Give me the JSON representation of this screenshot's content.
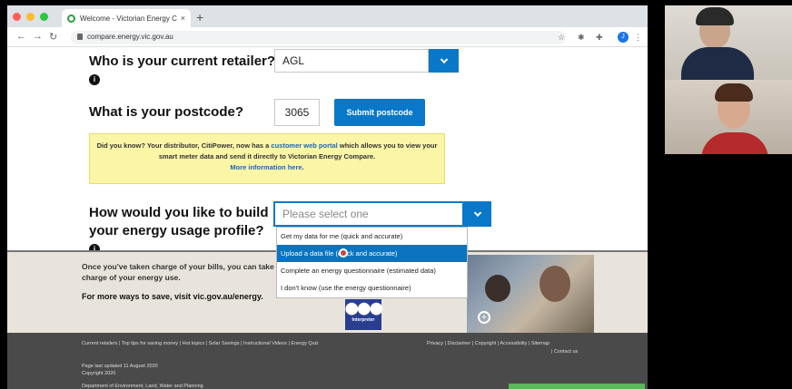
{
  "browser": {
    "tab_title": "Welcome - Victorian Energy Co",
    "tab_close": "×",
    "new_tab": "+",
    "url": "compare.energy.vic.gov.au",
    "profile_initial": "J"
  },
  "form": {
    "retailer_question": "Who is your current retailer?",
    "retailer_value": "AGL",
    "postcode_question": "What is your postcode?",
    "postcode_value": "3065",
    "submit_postcode": "Submit postcode",
    "usage_question": "How would you like to build your energy usage profile?",
    "usage_placeholder": "Please select one",
    "info_glyph": "i"
  },
  "notice": {
    "text_before": "Did you know? Your distributor, CitiPower, now has a",
    "link_portal": "customer web portal",
    "text_after": "which allows you to view your smart meter data and send it directly to Victorian Energy Compare.",
    "link_more": "More information here",
    "period": "."
  },
  "dropdown": {
    "options": [
      "Get my data for me (quick and accurate)",
      "Upload a data file (quick and accurate)",
      "Complete an energy questionnaire (estimated data)",
      "I don't know (use the energy questionnaire)"
    ],
    "highlighted_index": 1
  },
  "promo": {
    "line1": "Once you've taken charge of your bills, you can take charge of your energy use.",
    "line2": "For more ways to save, visit vic.gov.au/energy.",
    "interpreter_label": "Interpreter"
  },
  "footer": {
    "links": "Current retailers | Top tips for saving money | Hot topics | Solar Savings | Instructional Videos | Energy Quiz",
    "updated": "Page last updated 11 August 2020",
    "copyright": "Copyright 2020",
    "right_links": "Privacy | Disclaimer | Copyright | Accessibility | Sitemap",
    "contact": "| Contact us",
    "dept": "Department of Environment, Land, Water and Planning"
  },
  "colors": {
    "accent": "#0a78c8",
    "notice_bg": "#fbf5a6",
    "footer_bg": "#4a4a4a"
  }
}
